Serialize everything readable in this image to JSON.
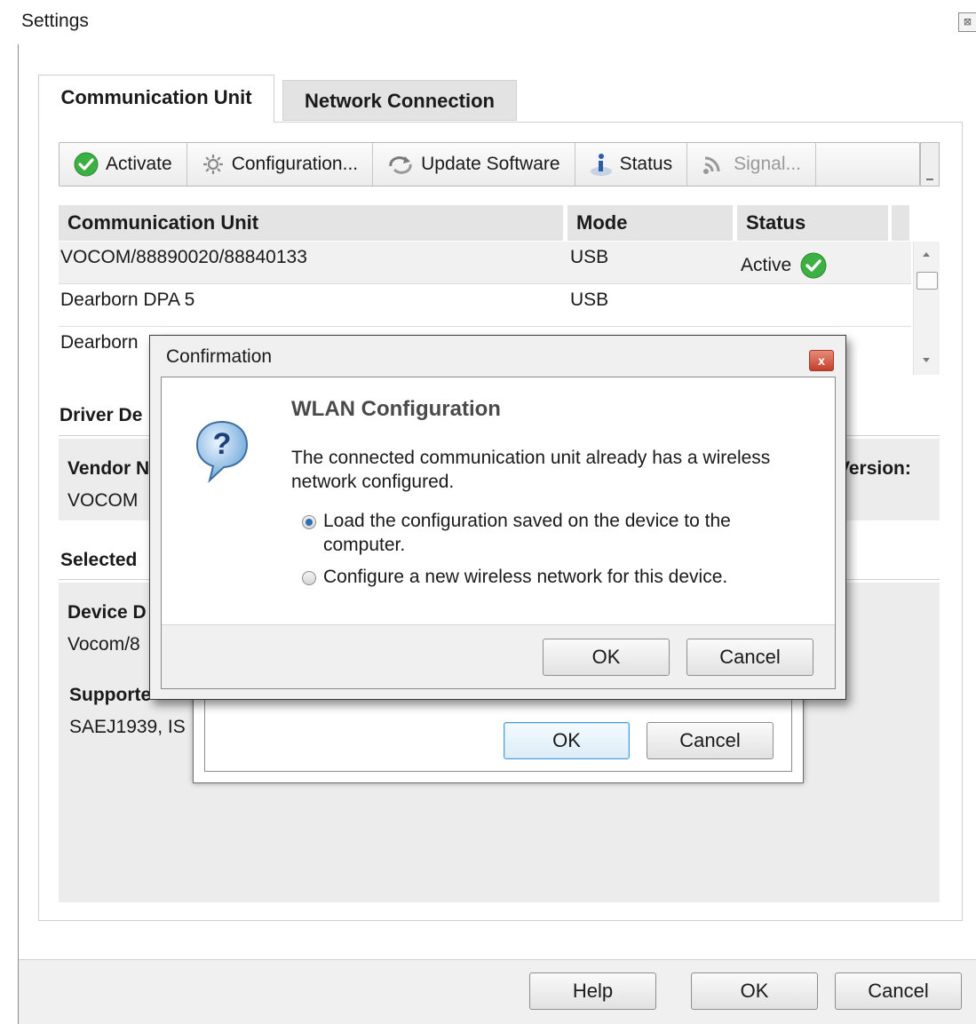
{
  "window": {
    "title": "Settings",
    "close_glyph": "⊠"
  },
  "tabs": [
    {
      "label": "Communication Unit",
      "active": true
    },
    {
      "label": "Network Connection",
      "active": false
    }
  ],
  "toolbar": {
    "activate": "Activate",
    "configuration": "Configuration...",
    "update_software": "Update Software",
    "status": "Status",
    "signal": "Signal..."
  },
  "table": {
    "headers": [
      "Communication Unit",
      "Mode",
      "Status"
    ],
    "rows": [
      {
        "unit": "VOCOM/88890020/88840133",
        "mode": "USB",
        "status": "Active"
      },
      {
        "unit": "Dearborn DPA 5",
        "mode": "USB",
        "status": ""
      },
      {
        "unit": "Dearborn",
        "mode": "",
        "status": ""
      }
    ]
  },
  "details": {
    "driver_section": "Driver De",
    "vendor_label": "Vendor N",
    "vendor_value": "VOCOM",
    "version_label": "Version:",
    "selected_section": "Selected",
    "device_label": "Device D",
    "device_value": "Vocom/8",
    "supported_label": "Supporte",
    "supported_value": "SAEJ1939, IS"
  },
  "background_dialog": {
    "ok": "OK",
    "cancel": "Cancel"
  },
  "confirmation": {
    "title": "Confirmation",
    "close_glyph": "x",
    "heading": "WLAN Configuration",
    "message": "The connected communication unit already has a wireless network configured.",
    "options": [
      {
        "label": "Load the configuration saved on the device to the computer.",
        "checked": true
      },
      {
        "label": "Configure a new wireless network for this device.",
        "checked": false
      }
    ],
    "ok": "OK",
    "cancel": "Cancel"
  },
  "footer": {
    "help": "Help",
    "ok": "OK",
    "cancel": "Cancel"
  },
  "colors": {
    "active_check": "#3cb043",
    "accent_blue": "#2b6fb0",
    "close_red": "#c2402c"
  }
}
